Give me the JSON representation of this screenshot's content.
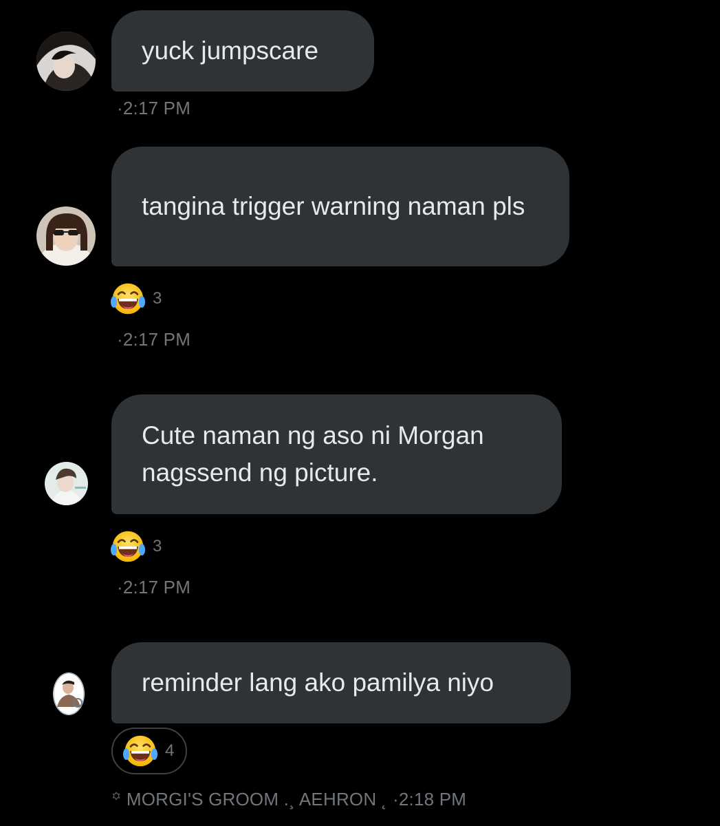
{
  "colors": {
    "background": "#000000",
    "bubble": "#2f3336",
    "text": "#e7e9ea",
    "muted": "#71767b"
  },
  "messages": [
    {
      "text": "yuck jumpscare",
      "timestamp": "·2:17 PM",
      "avatar": "user-avatar-1"
    },
    {
      "text": "tangina trigger warning naman pls",
      "timestamp": "·2:17 PM",
      "avatar": "user-avatar-2",
      "reaction": {
        "emoji": "face-with-tears-of-joy",
        "count": "3"
      }
    },
    {
      "text": "Cute naman ng aso ni Morgan nagssend ng picture.",
      "timestamp": "·2:17 PM",
      "avatar": "user-avatar-3",
      "reaction": {
        "emoji": "face-with-tears-of-joy",
        "count": "3"
      }
    },
    {
      "text": "reminder lang ako pamilya niyo",
      "timestamp": "꙳ MORGI'S GROOM .¸ AEHRON ˛ ·2:18 PM",
      "avatar": "user-avatar-4",
      "reaction": {
        "emoji": "face-with-tears-of-joy",
        "count": "4"
      }
    }
  ]
}
